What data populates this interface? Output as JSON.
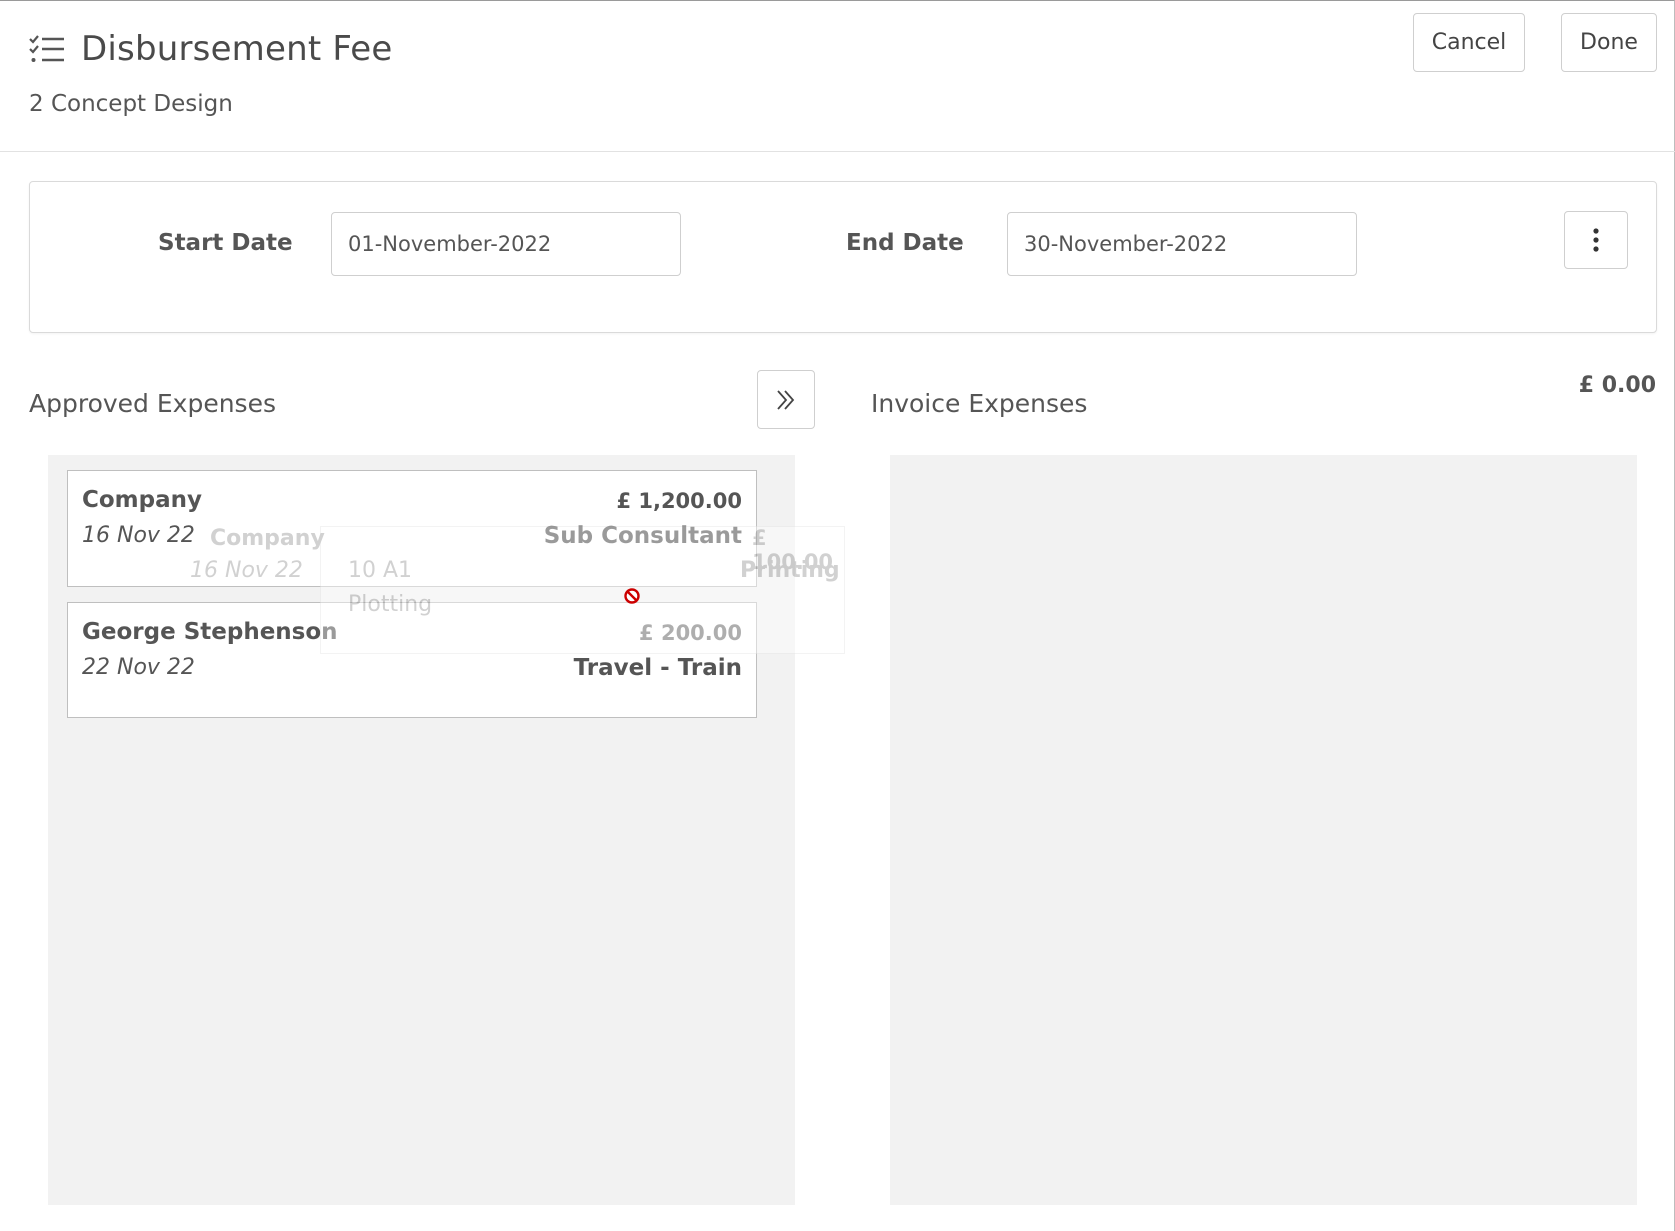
{
  "header": {
    "title": "Disbursement Fee",
    "subtitle": "2 Concept Design",
    "cancel_label": "Cancel",
    "done_label": "Done",
    "title_icon": "checklist-icon"
  },
  "dates": {
    "start_label": "Start Date",
    "start_value": "01-November-2022",
    "end_label": "End Date",
    "end_value": "30-November-2022",
    "menu_icon": "kebab-icon"
  },
  "approved": {
    "title": "Approved Expenses",
    "move_icon": "double-chevron-right-icon",
    "items": [
      {
        "name": "Company",
        "date": "16 Nov 22",
        "amount": "£ 1,200.00",
        "type": "Sub Consultant"
      },
      {
        "name": "George Stephenson",
        "date": "22 Nov 22",
        "amount": "£ 200.00",
        "type": "Travel - Train"
      }
    ]
  },
  "invoice": {
    "title": "Invoice Expenses",
    "total": "£ 0.00",
    "items": []
  },
  "drag_ghost": {
    "name": "Company",
    "date": "16 Nov 22",
    "desc_line1": "10 A1",
    "desc_line2": "Plotting",
    "amount": "£ 100.00",
    "type": "Printing",
    "cursor_icon": "no-drop-icon"
  },
  "colors": {
    "text": "#555555",
    "panel_bg": "#f2f2f2",
    "border": "#cfcfcf",
    "no_drop": "#cc0000"
  }
}
